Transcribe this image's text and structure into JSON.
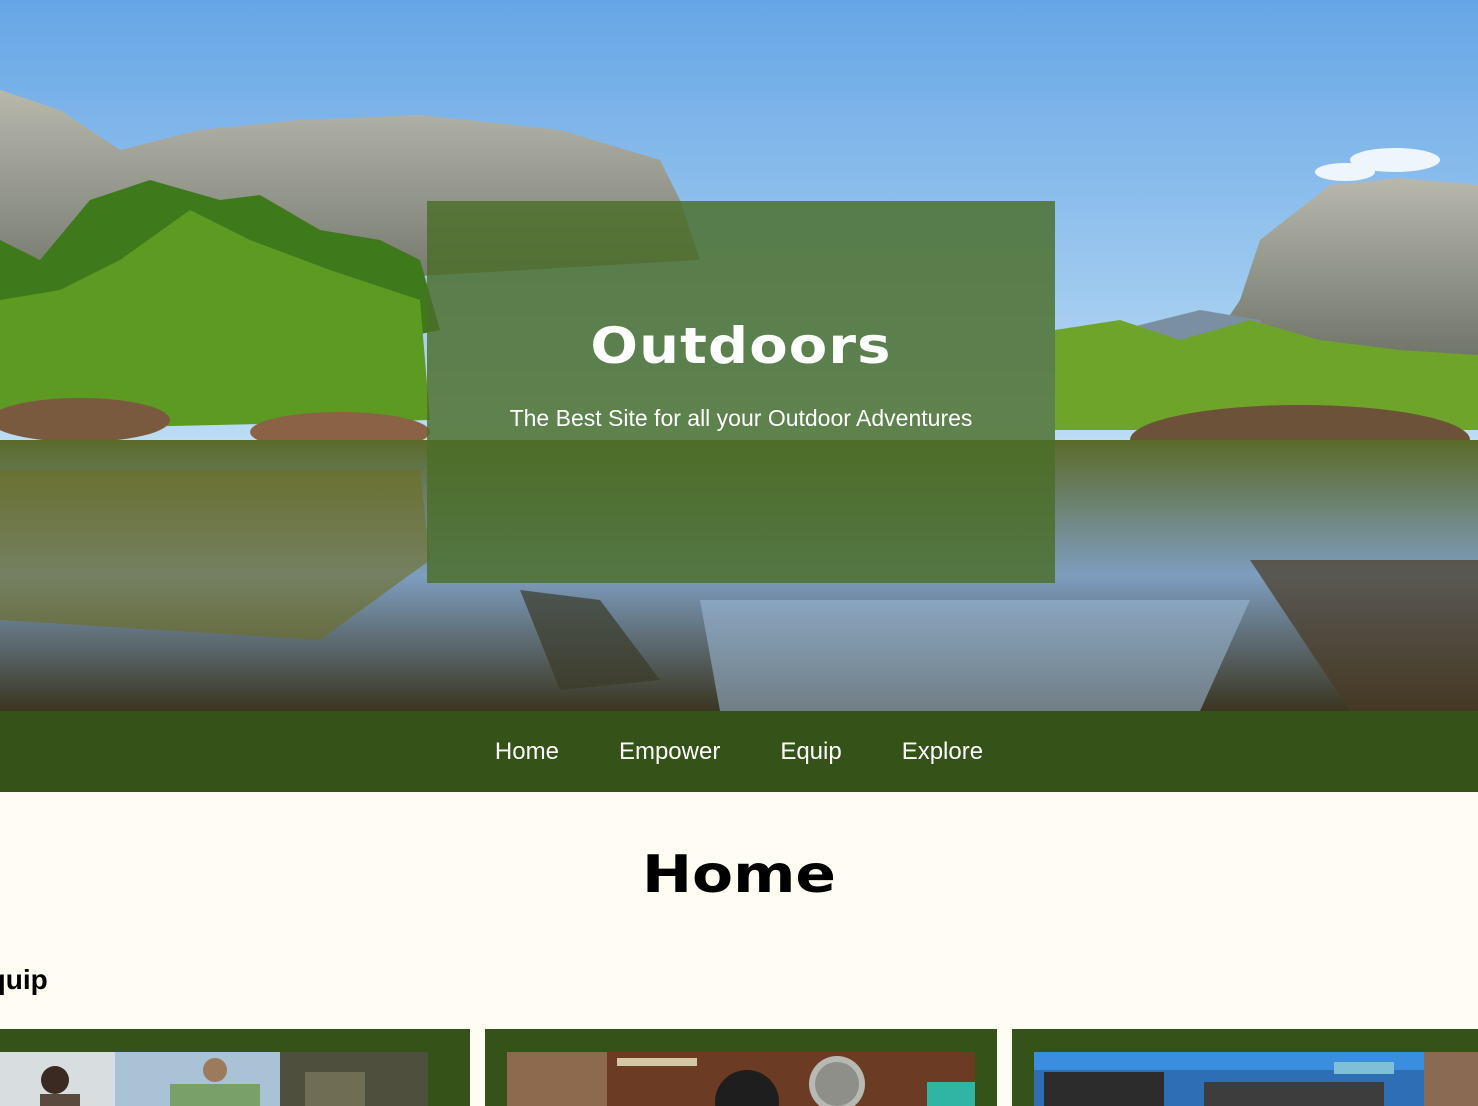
{
  "hero": {
    "title": "Outdoors",
    "subtitle": "The Best Site for all your Outdoor Adventures",
    "background_image": "mountain-lake-landscape"
  },
  "nav": {
    "items": [
      {
        "label": "Home"
      },
      {
        "label": "Empower"
      },
      {
        "label": "Equip"
      },
      {
        "label": "Explore"
      }
    ]
  },
  "main": {
    "title": "Home",
    "section_label": "Equip"
  },
  "cards": [
    {
      "image": "hikers-cooking-photo"
    },
    {
      "image": "camp-cookware-photo"
    },
    {
      "image": "camping-gear-photo"
    }
  ],
  "colors": {
    "nav_bg": "#355218",
    "hero_overlay": "#4a6e28",
    "page_bg": "#fefcf3",
    "card_bg": "#355218"
  }
}
